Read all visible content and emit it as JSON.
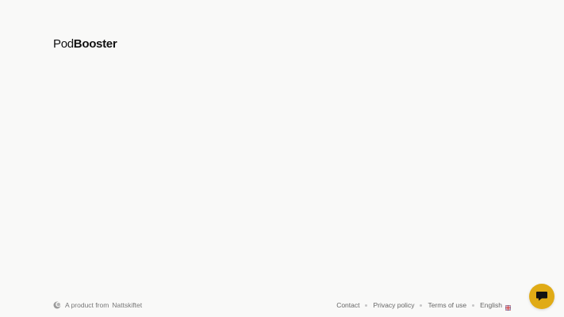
{
  "header": {
    "logo_part1": "Pod",
    "logo_part2": "Booster"
  },
  "footer": {
    "product_prefix": "A product from",
    "company": "Nattskiftet",
    "links": {
      "contact": "Contact",
      "privacy": "Privacy policy",
      "terms": "Terms of use",
      "language": "English"
    }
  },
  "icons": {
    "brand": "nattskiftet-logo-icon",
    "language_flag": "uk-flag-icon",
    "chat": "chat-bubble-icon"
  },
  "colors": {
    "background": "#f9f9f8",
    "chat_accent": "#e0ab16",
    "text": "#6b6b6b"
  }
}
